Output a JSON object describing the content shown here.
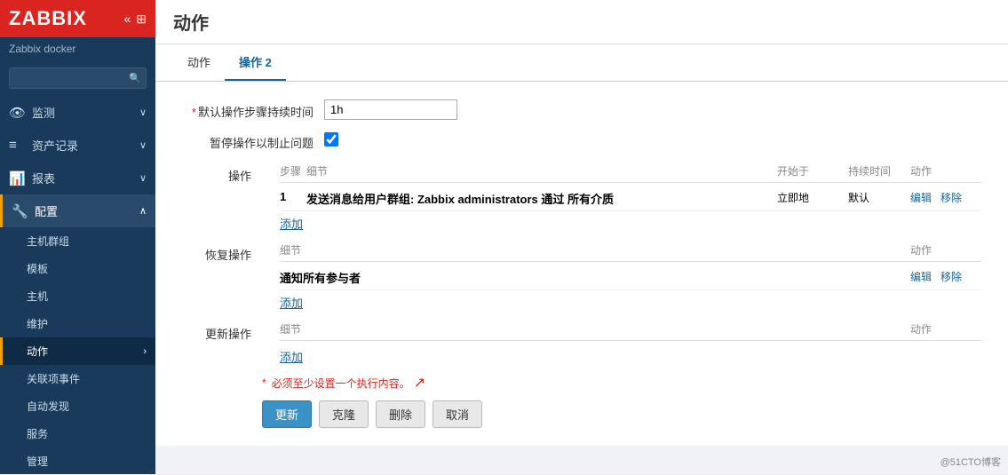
{
  "sidebar": {
    "logo": "ZABBIX",
    "subtitle": "Zabbix docker",
    "search_placeholder": "",
    "nav": [
      {
        "id": "monitor",
        "icon": "👁",
        "label": "监测",
        "chevron": "∨",
        "active": false
      },
      {
        "id": "assets",
        "icon": "≡",
        "label": "资产记录",
        "chevron": "∨",
        "active": false
      },
      {
        "id": "reports",
        "icon": "📊",
        "label": "报表",
        "chevron": "∨",
        "active": false
      },
      {
        "id": "config",
        "icon": "🔧",
        "label": "配置",
        "chevron": "∧",
        "active": true
      }
    ],
    "subnav": [
      {
        "id": "hostgroup",
        "label": "主机群组",
        "active": false
      },
      {
        "id": "template",
        "label": "模板",
        "active": false
      },
      {
        "id": "host",
        "label": "主机",
        "active": false
      },
      {
        "id": "maintenance",
        "label": "维护",
        "active": false
      },
      {
        "id": "action",
        "label": "动作",
        "active": true
      },
      {
        "id": "corr",
        "label": "关联项事件",
        "active": false
      },
      {
        "id": "discovery",
        "label": "自动发现",
        "active": false
      },
      {
        "id": "service",
        "label": "服务",
        "active": false
      },
      {
        "id": "admin",
        "label": "管理",
        "active": false
      }
    ]
  },
  "page": {
    "title": "动作"
  },
  "tabs": [
    {
      "id": "action-tab",
      "label": "动作",
      "active": false
    },
    {
      "id": "ops-tab",
      "label": "操作 2",
      "active": true
    }
  ],
  "form": {
    "default_step_duration_label": "默认操作步骤持续时间",
    "default_step_duration_value": "1h",
    "pause_label": "暂停操作以制止问题",
    "operations_label": "操作",
    "ops_cols": {
      "step": "步骤",
      "detail": "细节",
      "start": "开始于",
      "duration": "持续时间",
      "action": "动作"
    },
    "ops_row": {
      "step": "1",
      "detail": "发送消息给用户群组: Zabbix administrators 通过 所有介质",
      "start": "立即地",
      "duration": "默认",
      "edit": "编辑",
      "remove": "移除"
    },
    "ops_add": "添加",
    "recovery_label": "恢复操作",
    "recovery_cols": {
      "detail": "细节",
      "action": "动作"
    },
    "recovery_row": {
      "detail": "通知所有参与者",
      "edit": "编辑",
      "remove": "移除"
    },
    "recovery_add": "添加",
    "update_label": "更新操作",
    "update_cols": {
      "detail": "细节",
      "action": "动作"
    },
    "update_add": "添加",
    "error_msg": "必须至少设置一个执行内容。",
    "btn_update": "更新",
    "btn_clone": "克隆",
    "btn_delete": "删除",
    "btn_cancel": "取消"
  },
  "watermark": "@51CTO博客"
}
